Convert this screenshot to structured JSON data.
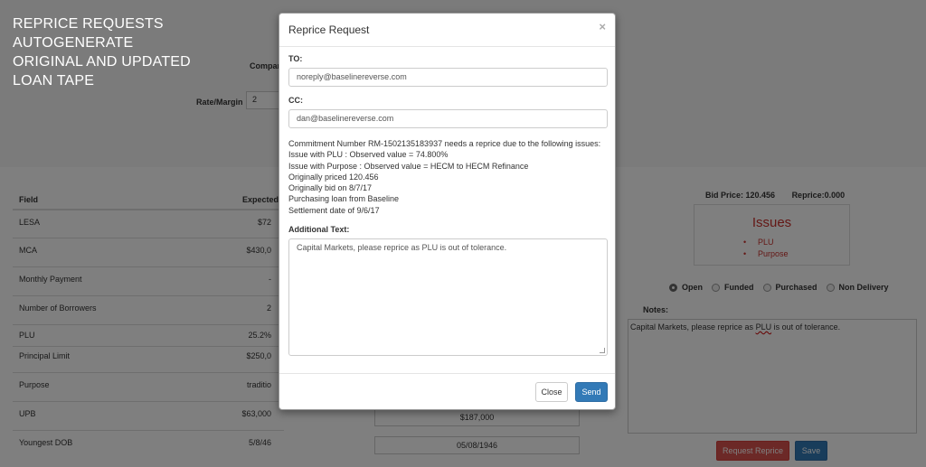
{
  "caption": {
    "lines": [
      "REPRICE REQUESTS",
      "AUTOGENERATE",
      "ORIGINAL AND UPDATED",
      "LOAN TAPE"
    ]
  },
  "form": {
    "company_label": "Compar",
    "rate_label": "Rate/Margin",
    "rate_value": "2"
  },
  "table": {
    "headers": {
      "field": "Field",
      "expected": "Expected"
    },
    "rows": [
      {
        "field": "LESA",
        "expected": "$72"
      },
      {
        "field": "MCA",
        "expected": "$430,0"
      },
      {
        "field": "Monthly Payment",
        "expected": "-"
      },
      {
        "field": "Number of Borrowers",
        "expected": "2"
      },
      {
        "field": "PLU",
        "expected": "25.2%"
      },
      {
        "field": "Principal Limit",
        "expected": "$250,0"
      },
      {
        "field": "Purpose",
        "expected": "traditio"
      },
      {
        "field": "UPB",
        "expected": "$63,000"
      },
      {
        "field": "Youngest DOB",
        "expected": "5/8/46"
      }
    ],
    "actual_values": {
      "upb": "$187,000",
      "dob": "05/08/1946"
    }
  },
  "side": {
    "bid_price": "Bid Price: 120.456",
    "reprice": "Reprice:0.000",
    "issues_title": "Issues",
    "issues": [
      "PLU",
      "Purpose"
    ],
    "status_options": [
      "Open",
      "Funded",
      "Purchased",
      "Non Delivery"
    ],
    "status_selected": "Open",
    "notes_label": "Notes:",
    "notes_prefix": "Capital Markets, please reprice as ",
    "notes_word": "PLU",
    "notes_suffix": " is out of tolerance.",
    "request_reprice_label": "Request Reprice",
    "save_label": "Save"
  },
  "modal": {
    "title": "Reprice Request",
    "close_glyph": "×",
    "to_label": "TO:",
    "to_value": "noreply@baselinereverse.com",
    "cc_label": "CC:",
    "cc_value": "dan@baselinereverse.com",
    "body_lines": [
      "Commitment Number RM-1502135183937 needs a reprice due to the following issues:",
      "Issue with PLU : Observed value = 74.800%",
      "Issue with Purpose : Observed value = HECM to HECM Refinance",
      "Originally priced 120.456",
      "Originally bid on 8/7/17",
      "Purchasing loan from Baseline",
      "Settlement date of 9/6/17"
    ],
    "additional_label": "Additional Text:",
    "additional_text": "Capital Markets, please reprice as PLU is out of tolerance.",
    "close_button": "Close",
    "send_button": "Send"
  },
  "colors": {
    "primary": "#337ab7",
    "danger": "#d9534f",
    "issues_red": "#c9302c"
  }
}
